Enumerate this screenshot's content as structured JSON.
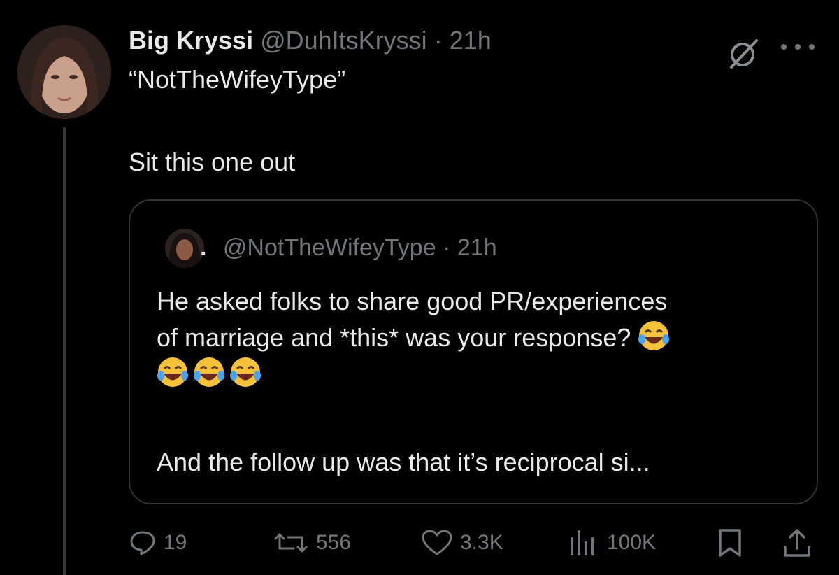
{
  "tweet": {
    "display_name": "Big Kryssi",
    "handle": "@DuhItsKryssi",
    "separator": "·",
    "time": "21h",
    "quote_title": "“NotTheWifeyType”",
    "text": "Sit this one out"
  },
  "quoted": {
    "display_name": ".",
    "handle": "@NotTheWifeyType",
    "separator": "·",
    "time": "21h",
    "lines": [
      "He asked folks to share good PR/experiences",
      "of marriage and *this* was your response?"
    ],
    "continuation": "And the follow up was that it’s reciprocal si..."
  },
  "actions": {
    "replies": "19",
    "reposts": "556",
    "likes": "3.3K",
    "views": "100K"
  },
  "icons": {
    "reply": "reply-icon",
    "repost": "repost-icon",
    "like": "heart-icon",
    "views": "views-icon",
    "bookmark": "bookmark-icon",
    "share": "share-icon",
    "grok": "grok-icon",
    "more": "more-icon",
    "emoji": "face-with-tears-of-joy"
  },
  "colors": {
    "background": "#000000",
    "text": "#e7e9ea",
    "muted": "#71767b",
    "border": "#2f3336"
  }
}
